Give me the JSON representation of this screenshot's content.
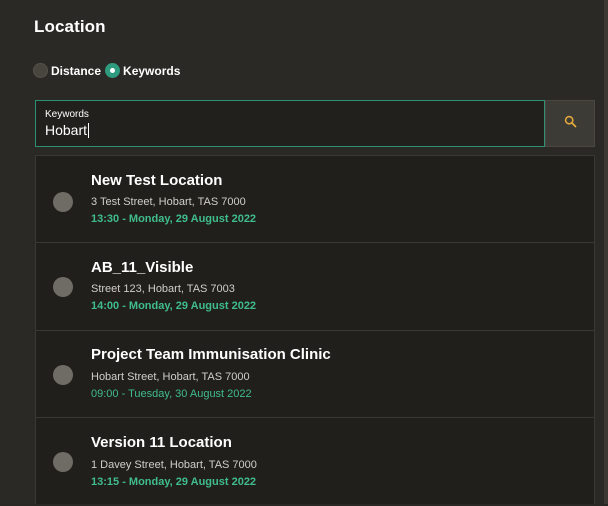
{
  "header": {
    "title": "Location"
  },
  "search_mode": {
    "options": [
      {
        "label": "Distance",
        "selected": false
      },
      {
        "label": "Keywords",
        "selected": true
      }
    ]
  },
  "search": {
    "label": "Keywords",
    "value": "Hobart",
    "button_icon": "search-icon"
  },
  "colors": {
    "accent": "#2e9a7e",
    "time_text": "#3fbd8b",
    "search_icon": "#e0a83a"
  },
  "locations": [
    {
      "name": "New Test Location",
      "address": "3 Test Street, Hobart, TAS 7000",
      "time": "13:30 - Monday, 29 August 2022"
    },
    {
      "name": "AB_11_Visible",
      "address": "Street 123, Hobart, TAS 7003",
      "time": "14:00 - Monday, 29 August 2022"
    },
    {
      "name": "Project Team Immunisation Clinic",
      "address": "Hobart Street, Hobart, TAS 7000",
      "time": "09:00 - Tuesday, 30 August 2022"
    },
    {
      "name": "Version 11 Location",
      "address": "1 Davey Street, Hobart, TAS 7000",
      "time": "13:15 - Monday, 29 August 2022"
    }
  ]
}
